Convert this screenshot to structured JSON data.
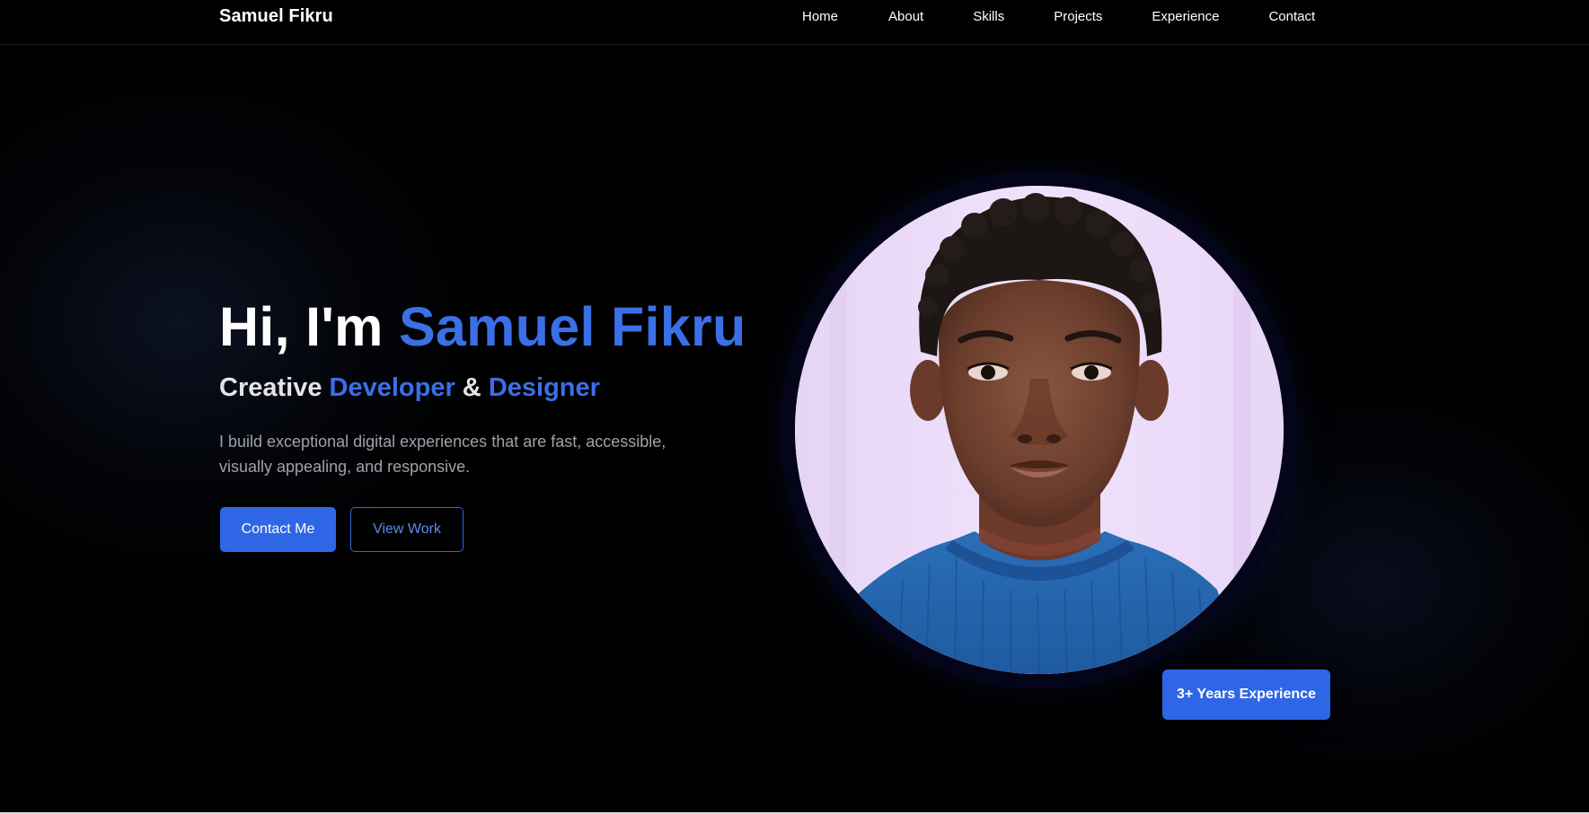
{
  "header": {
    "brand": "Samuel Fikru",
    "nav": [
      "Home",
      "About",
      "Skills",
      "Projects",
      "Experience",
      "Contact"
    ]
  },
  "hero": {
    "greeting": "Hi, I'm ",
    "name": "Samuel Fikru",
    "subtitle_part1": "Creative ",
    "subtitle_accent1": "Developer",
    "subtitle_part2": " & ",
    "subtitle_accent2": "Designer",
    "description": "I build exceptional digital experiences that are fast, accessible, visually appealing, and responsive.",
    "primary_button": "Contact Me",
    "secondary_button": "View Work",
    "badge": "3+ Years Experience"
  },
  "colors": {
    "accent": "#3b6fe5",
    "button": "#2f66e6",
    "background": "#000000"
  }
}
